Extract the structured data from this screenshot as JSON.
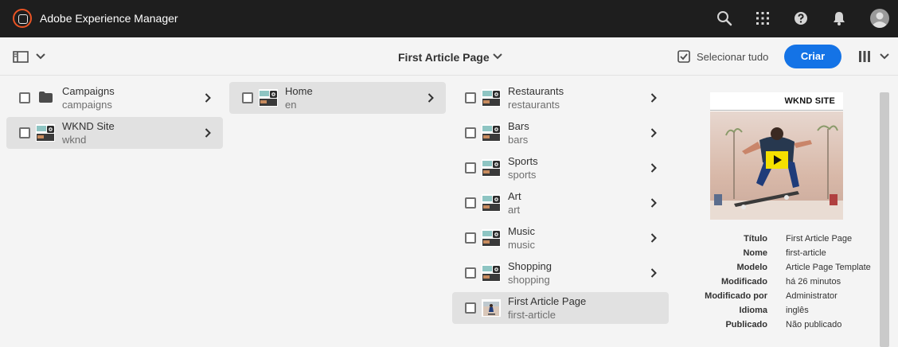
{
  "shell": {
    "title": "Adobe Experience Manager",
    "icons": [
      "search-icon",
      "apps-grid-icon",
      "help-icon",
      "notifications-bell-icon",
      "user-avatar-icon"
    ]
  },
  "actionbar": {
    "rail_toggle_icon": "rail-toggle-icon",
    "page_title": "First Article Page",
    "select_all": "Selecionar tudo",
    "create": "Criar",
    "view_icon": "column-view-icon"
  },
  "columns": [
    {
      "items": [
        {
          "title": "Campaigns",
          "subtitle": "campaigns",
          "icon": "folder-icon",
          "selected": false,
          "has_children": true
        },
        {
          "title": "WKND Site",
          "subtitle": "wknd",
          "icon": "page-thumbnail",
          "selected": true,
          "has_children": true
        }
      ]
    },
    {
      "items": [
        {
          "title": "Home",
          "subtitle": "en",
          "icon": "page-thumbnail",
          "selected": true,
          "has_children": true
        }
      ]
    },
    {
      "items": [
        {
          "title": "Restaurants",
          "subtitle": "restaurants",
          "icon": "page-thumbnail",
          "selected": false,
          "has_children": true
        },
        {
          "title": "Bars",
          "subtitle": "bars",
          "icon": "page-thumbnail",
          "selected": false,
          "has_children": true
        },
        {
          "title": "Sports",
          "subtitle": "sports",
          "icon": "page-thumbnail",
          "selected": false,
          "has_children": true
        },
        {
          "title": "Art",
          "subtitle": "art",
          "icon": "page-thumbnail",
          "selected": false,
          "has_children": true
        },
        {
          "title": "Music",
          "subtitle": "music",
          "icon": "page-thumbnail",
          "selected": false,
          "has_children": true
        },
        {
          "title": "Shopping",
          "subtitle": "shopping",
          "icon": "page-thumbnail",
          "selected": false,
          "has_children": true
        },
        {
          "title": "First Article Page",
          "subtitle": "first-article",
          "icon": "skater-thumbnail",
          "selected": true,
          "has_children": false
        }
      ]
    }
  ],
  "preview": {
    "image_caption": "WKND SITE",
    "meta": [
      {
        "key": "Título",
        "value": "First Article Page"
      },
      {
        "key": "Nome",
        "value": "first-article"
      },
      {
        "key": "Modelo",
        "value": "Article Page Template"
      },
      {
        "key": "Modificado",
        "value": "há 26 minutos"
      },
      {
        "key": "Modificado por",
        "value": "Administrator"
      },
      {
        "key": "Idioma",
        "value": "inglês"
      },
      {
        "key": "Publicado",
        "value": "Não publicado"
      }
    ]
  },
  "colors": {
    "accent": "#1473e6",
    "shell": "#1e1e1e",
    "logo": "#eb5424",
    "selected_row": "#e1e1e1"
  }
}
